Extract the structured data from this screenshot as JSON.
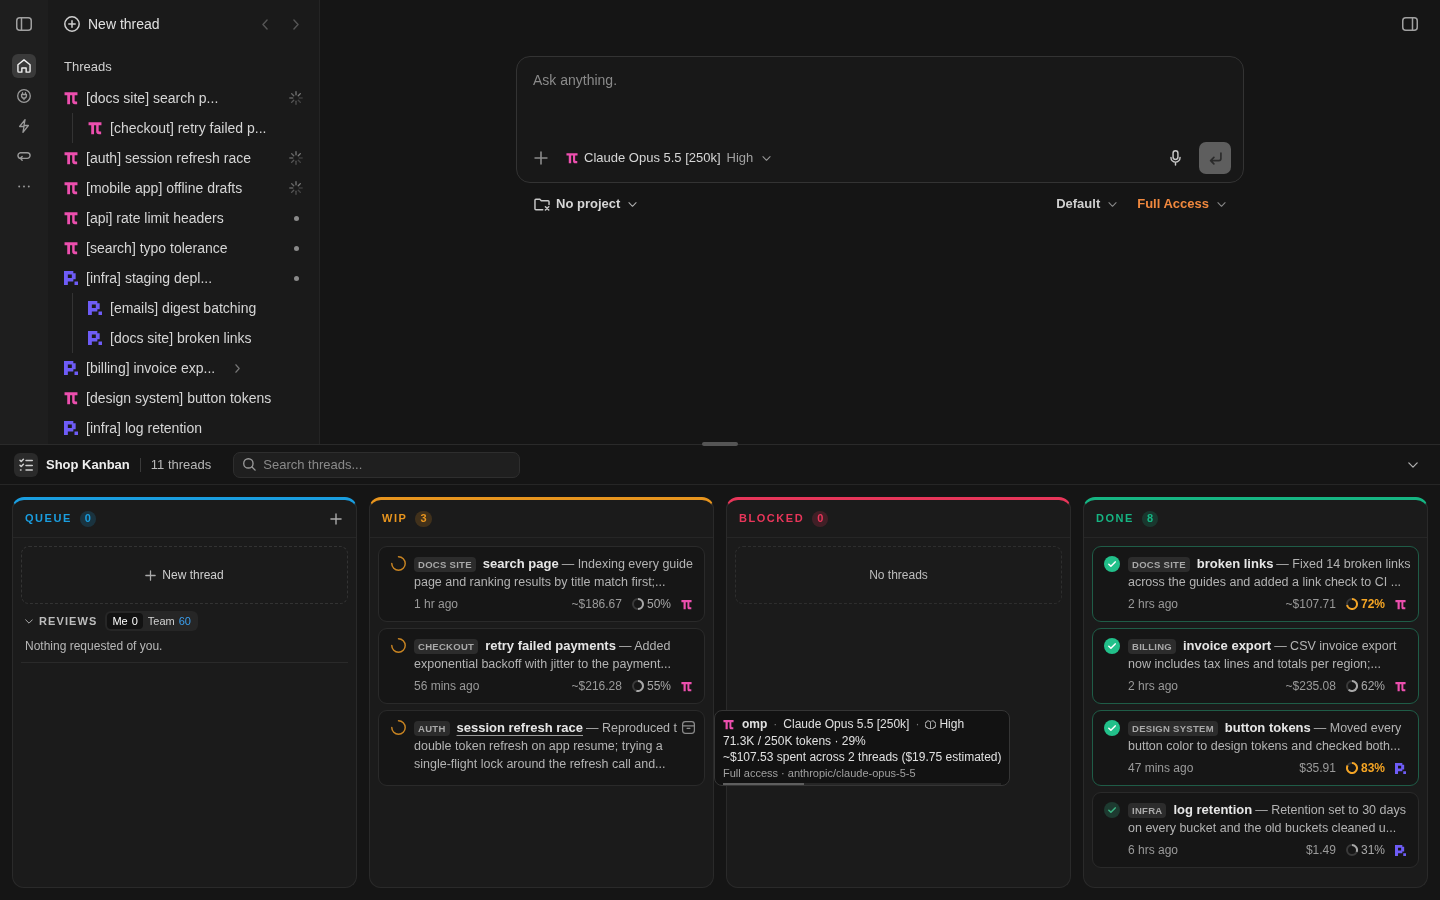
{
  "rail": [
    {
      "kind": "home",
      "selected": true
    },
    {
      "kind": "plug",
      "selected": false
    },
    {
      "kind": "bolt",
      "selected": false
    },
    {
      "kind": "loop",
      "selected": false
    },
    {
      "kind": "more",
      "selected": false
    }
  ],
  "sidebar": {
    "new_thread": "New thread",
    "heading": "Threads",
    "threads": [
      {
        "agent": {
          "kind": "pi"
        },
        "label": "[docs site] search p...",
        "indicator": {
          "kind": "spinner"
        },
        "children": [
          {
            "agent": {
              "kind": "pi"
            },
            "label": "[checkout] retry failed p..."
          }
        ]
      },
      {
        "agent": {
          "kind": "pi"
        },
        "label": "[auth] session refresh race",
        "indicator": {
          "kind": "spinner"
        }
      },
      {
        "agent": {
          "kind": "pi"
        },
        "label": "[mobile app] offline drafts",
        "indicator": {
          "kind": "spinner"
        }
      },
      {
        "agent": {
          "kind": "pi"
        },
        "label": "[api] rate limit headers",
        "indicator": {
          "kind": "dot"
        }
      },
      {
        "agent": {
          "kind": "pi"
        },
        "label": "[search] typo tolerance",
        "indicator": {
          "kind": "dot"
        }
      },
      {
        "agent": {
          "kind": "block"
        },
        "label": "[infra] staging depl...",
        "indicator": {
          "kind": "dot"
        },
        "children": [
          {
            "agent": {
              "kind": "block"
            },
            "label": "[emails] digest batching"
          },
          {
            "agent": {
              "kind": "block"
            },
            "label": "[docs site] broken links"
          }
        ]
      },
      {
        "agent": {
          "kind": "block"
        },
        "label": "[billing] invoice exp...",
        "expanded": false
      },
      {
        "agent": {
          "kind": "pi"
        },
        "label": "[design system] button tokens"
      },
      {
        "agent": {
          "kind": "block"
        },
        "label": "[infra] log retention"
      }
    ]
  },
  "composer": {
    "placeholder": "Ask anything.",
    "agent": {
      "kind": "pi"
    },
    "model": "Claude Opus 5.5 [250k]",
    "effort": "High",
    "project": "No project",
    "mode": "Default",
    "access": "Full Access"
  },
  "kanban": {
    "title": "Shop Kanban",
    "count": "11 threads",
    "search": {
      "placeholder": "Search threads..."
    },
    "columns": [
      {
        "label": "QUEUE",
        "count": "0",
        "color": "#1a9ee0",
        "addable": true,
        "new_thread": "New thread",
        "reviews": {
          "label": "REVIEWS",
          "expanded": true,
          "filters": [
            {
              "label": "Me",
              "count": "0",
              "selected": true,
              "count_highlighted": false
            },
            {
              "label": "Team",
              "count": "60",
              "selected": false,
              "count_highlighted": true
            }
          ],
          "empty": "Nothing requested of you."
        }
      },
      {
        "label": "WIP",
        "count": "3",
        "color": "#e8951e",
        "addable": false,
        "cards": [
          {
            "kind": "running",
            "tag": "DOCS SITE",
            "title": "search page",
            "hovered": false,
            "summary": [
              "— Indexing every guide",
              "page and ranking results by title match first;..."
            ],
            "time": "1 hr ago",
            "cost": "~$186.67",
            "usage": "50%",
            "level": 0.5,
            "agent": {
              "kind": "pi"
            }
          },
          {
            "kind": "running",
            "tag": "CHECKOUT",
            "title": "retry failed payments",
            "hovered": false,
            "summary": [
              "— Added",
              "exponential backoff with jitter to the payment..."
            ],
            "time": "56 mins ago",
            "cost": "~$216.28",
            "usage": "55%",
            "level": 0.55,
            "agent": {
              "kind": "pi"
            }
          },
          {
            "kind": "running",
            "tag": "AUTH",
            "title": "session refresh race",
            "hovered": true,
            "summary": [
              "— Reproduced t",
              "double token refresh on app resume; trying a",
              "single-flight lock around the refresh call and..."
            ],
            "tooltip": {
              "segments": [
                {
                  "kind": "agent",
                  "agent": {
                    "kind": "pi"
                  },
                  "text": "omp"
                },
                {
                  "kind": "separator",
                  "text": "·"
                },
                {
                  "kind": "model",
                  "text": "Claude Opus 5.5 [250k]"
                },
                {
                  "kind": "separator",
                  "text": "·"
                },
                {
                  "kind": "effort",
                  "text": "High"
                }
              ],
              "tokens": "71.3K / 250K tokens · 29%",
              "spend": "~$107.53 spent across 2 threads ($19.75 estimated)",
              "details": "Full access · anthropic/claude-opus-5-5",
              "level": 0.29
            }
          }
        ]
      },
      {
        "label": "BLOCKED",
        "count": "0",
        "color": "#e8365a",
        "addable": false,
        "empty": "No threads"
      },
      {
        "label": "DONE",
        "count": "8",
        "color": "#16b583",
        "addable": false,
        "cards": [
          {
            "kind": "done",
            "highlighted": true,
            "tag": "DOCS SITE",
            "title": "broken links",
            "hovered": false,
            "summary": [
              "— Fixed 14 broken links",
              "across the guides and added a link check to CI ..."
            ],
            "time": "2 hrs ago",
            "cost": "~$107.71",
            "usage": "72%",
            "level": 0.72,
            "agent": {
              "kind": "pi"
            }
          },
          {
            "kind": "done",
            "highlighted": true,
            "tag": "BILLING",
            "title": "invoice export",
            "hovered": false,
            "summary": [
              "— CSV invoice export",
              "now includes tax lines and totals per region;..."
            ],
            "time": "2 hrs ago",
            "cost": "~$235.08",
            "usage": "62%",
            "level": 0.62,
            "agent": {
              "kind": "pi"
            }
          },
          {
            "kind": "done",
            "highlighted": true,
            "tag": "DESIGN SYSTEM",
            "title": "button tokens",
            "hovered": false,
            "summary": [
              "— Moved every",
              "button color to design tokens and checked both..."
            ],
            "time": "47 mins ago",
            "cost": "$35.91",
            "usage": "83%",
            "level": 0.83,
            "agent": {
              "kind": "block"
            }
          },
          {
            "kind": "done",
            "highlighted": false,
            "tag": "INFRA",
            "title": "log retention",
            "hovered": false,
            "summary": [
              "— Retention set to 30 days",
              "on every bucket and the old buckets cleaned u..."
            ],
            "time": "6 hrs ago",
            "cost": "$1.49",
            "usage": "31%",
            "level": 0.31,
            "agent": {
              "kind": "block"
            }
          }
        ]
      }
    ]
  }
}
